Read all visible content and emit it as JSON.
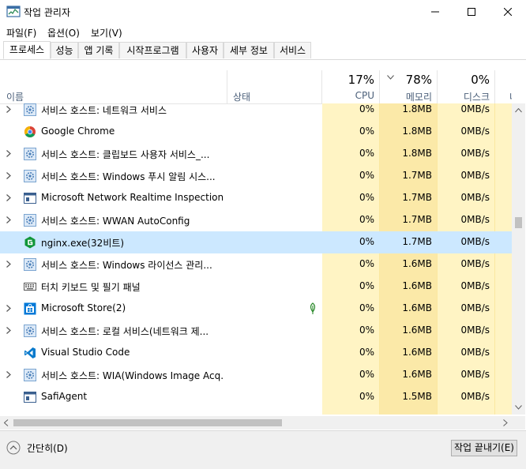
{
  "window": {
    "title": "작업 관리자",
    "controls": [
      "minimize",
      "maximize",
      "close"
    ]
  },
  "menu": [
    {
      "label": "파일(F)"
    },
    {
      "label": "옵션(O)"
    },
    {
      "label": "보기(V)"
    }
  ],
  "tabs": [
    {
      "label": "프로세스",
      "active": true
    },
    {
      "label": "성능"
    },
    {
      "label": "앱 기록"
    },
    {
      "label": "시작프로그램"
    },
    {
      "label": "사용자"
    },
    {
      "label": "세부 정보"
    },
    {
      "label": "서비스"
    }
  ],
  "columns": {
    "name": "이름",
    "status": "상태",
    "cpu": {
      "percent": "17%",
      "label": "CPU"
    },
    "memory": {
      "percent": "78%",
      "label": "메모리"
    },
    "disk": {
      "percent": "0%",
      "label": "디스크"
    },
    "network": {
      "label": "네트"
    }
  },
  "processes": [
    {
      "name": "서비스 호스트: 네트워크 서비스",
      "icon": "gear-icon",
      "expandable": true,
      "cpu": "0%",
      "memory": "1.8MB",
      "disk": "0MB/s"
    },
    {
      "name": "Google Chrome",
      "icon": "chrome-icon",
      "expandable": false,
      "cpu": "0%",
      "memory": "1.8MB",
      "disk": "0MB/s"
    },
    {
      "name": "서비스 호스트: 클립보드 사용자 서비스_...",
      "icon": "gear-icon",
      "expandable": true,
      "cpu": "0%",
      "memory": "1.8MB",
      "disk": "0MB/s"
    },
    {
      "name": "서비스 호스트: Windows 푸시 알림 시스...",
      "icon": "gear-icon",
      "expandable": true,
      "cpu": "0%",
      "memory": "1.7MB",
      "disk": "0MB/s"
    },
    {
      "name": "Microsoft Network Realtime Inspection S...",
      "icon": "window-icon",
      "expandable": true,
      "cpu": "0%",
      "memory": "1.7MB",
      "disk": "0MB/s"
    },
    {
      "name": "서비스 호스트: WWAN AutoConfig",
      "icon": "gear-icon",
      "expandable": true,
      "cpu": "0%",
      "memory": "1.7MB",
      "disk": "0MB/s"
    },
    {
      "name": "nginx.exe(32비트)",
      "icon": "nginx-icon",
      "expandable": false,
      "selected": true,
      "cpu": "0%",
      "memory": "1.7MB",
      "disk": "0MB/s"
    },
    {
      "name": "서비스 호스트: Windows 라이선스 관리...",
      "icon": "gear-icon",
      "expandable": true,
      "cpu": "0%",
      "memory": "1.6MB",
      "disk": "0MB/s"
    },
    {
      "name": "터치 키보드 및 필기 패널",
      "icon": "keyboard-icon",
      "expandable": false,
      "cpu": "0%",
      "memory": "1.6MB",
      "disk": "0MB/s"
    },
    {
      "name": "Microsoft Store(2)",
      "icon": "store-icon",
      "expandable": true,
      "suspended_leaf": true,
      "cpu": "0%",
      "memory": "1.6MB",
      "disk": "0MB/s"
    },
    {
      "name": "서비스 호스트: 로컬 서비스(네트워크 제...",
      "icon": "gear-icon",
      "expandable": true,
      "cpu": "0%",
      "memory": "1.6MB",
      "disk": "0MB/s"
    },
    {
      "name": "Visual Studio Code",
      "icon": "vscode-icon",
      "expandable": false,
      "cpu": "0%",
      "memory": "1.6MB",
      "disk": "0MB/s"
    },
    {
      "name": "서비스 호스트: WIA(Windows Image Acq...",
      "icon": "gear-icon",
      "expandable": true,
      "cpu": "0%",
      "memory": "1.6MB",
      "disk": "0MB/s"
    },
    {
      "name": "SafiAgent",
      "icon": "window-icon",
      "expandable": false,
      "cpu": "0%",
      "memory": "1.5MB",
      "disk": "0MB/s"
    }
  ],
  "footer": {
    "fewer_details": "간단히(D)",
    "end_task": "작업 끝내기(E)"
  }
}
